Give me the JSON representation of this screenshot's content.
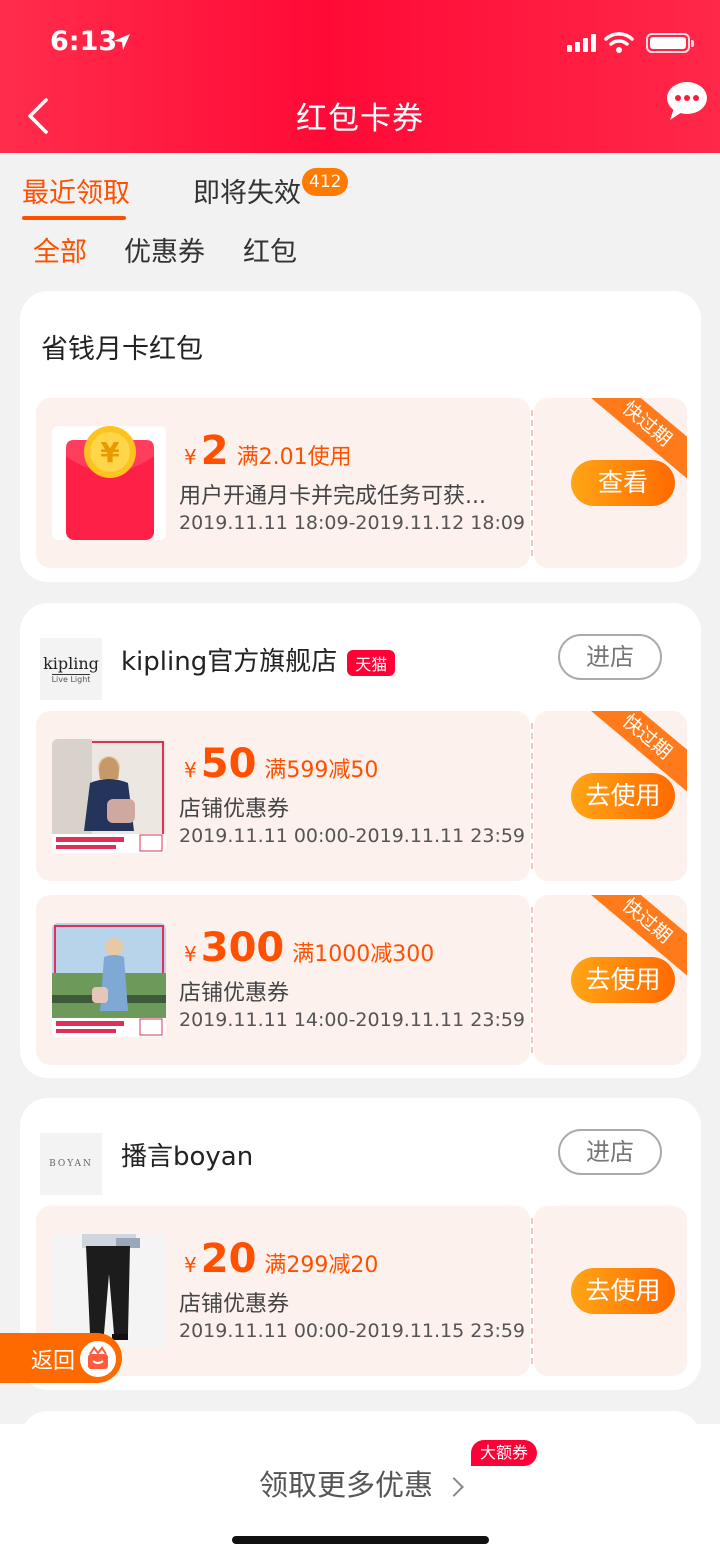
{
  "status_bar": {
    "time": "6:13",
    "icons": [
      "location-arrow-icon",
      "signal-icon",
      "wifi-icon",
      "battery-icon"
    ]
  },
  "nav": {
    "title": "红包卡券",
    "back_icon": "chevron-left-icon",
    "message_icon": "chat-bubble-icon"
  },
  "tabs": {
    "recent": "最近领取",
    "expiring": "即将失效",
    "expiring_count": "412"
  },
  "subtabs": [
    "全部",
    "优惠券",
    "红包"
  ],
  "colors": {
    "brand_red": "#ff0a36",
    "accent_orange": "#ff5000",
    "tmall_red": "#ff0036"
  },
  "card_monthly": {
    "title": "省钱月卡红包",
    "coupon": {
      "yen": "¥",
      "amount": "2",
      "condition": "满2.01使用",
      "desc": "用户开通月卡并完成任务可获...",
      "date": "2019.11.11 18:09-2019.11.12 18:09",
      "ribbon": "快过期",
      "button": "查看",
      "thumb_icon": "red-envelope-icon"
    }
  },
  "card_kipling": {
    "shop_name": "kipling官方旗舰店",
    "tag": "天猫",
    "enter_button": "进店",
    "logo_text": "kipling",
    "logo_sub": "Live Light",
    "coupons": [
      {
        "yen": "¥",
        "amount": "50",
        "condition": "满599减50",
        "desc": "店铺优惠券",
        "date": "2019.11.11 00:00-2019.11.11 23:59",
        "ribbon": "快过期",
        "button": "去使用"
      },
      {
        "yen": "¥",
        "amount": "300",
        "condition": "满1000减300",
        "desc": "店铺优惠券",
        "date": "2019.11.11 14:00-2019.11.11 23:59",
        "ribbon": "快过期",
        "button": "去使用"
      }
    ]
  },
  "card_boyan": {
    "shop_name": "播言boyan",
    "enter_button": "进店",
    "logo_text": "BOYAN",
    "coupon": {
      "yen": "¥",
      "amount": "20",
      "condition": "满299减20",
      "desc": "店铺优惠券",
      "date": "2019.11.11 00:00-2019.11.15 23:59",
      "button": "去使用"
    }
  },
  "float_back": {
    "label": "返回",
    "icon": "gift-box-icon"
  },
  "bottom": {
    "more_label": "领取更多优惠",
    "badge": "大额券"
  }
}
